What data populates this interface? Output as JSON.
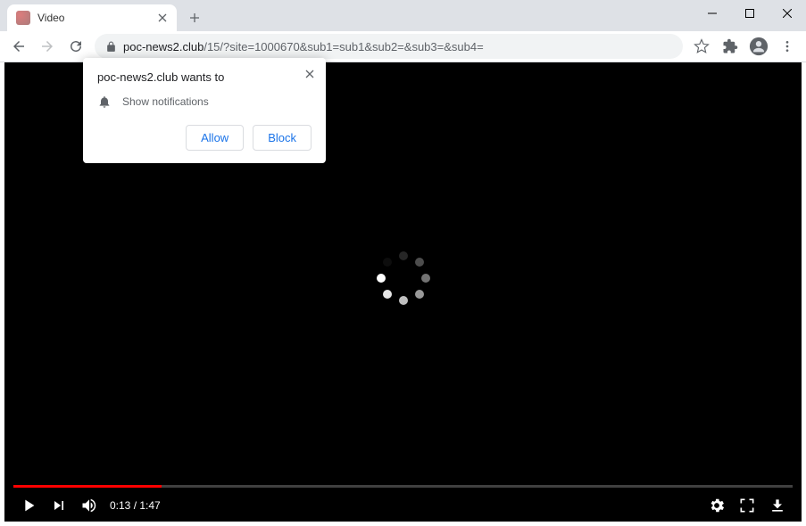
{
  "window": {
    "minimize_tip": "Minimize",
    "maximize_tip": "Maximize",
    "close_tip": "Close"
  },
  "tab": {
    "title": "Video",
    "close_tip": "Close tab",
    "newtab_tip": "New tab"
  },
  "toolbar": {
    "back_tip": "Back",
    "forward_tip": "Forward",
    "reload_tip": "Reload",
    "url_host": "poc-news2.club",
    "url_path": "/15/?site=1000670&sub1=sub1&sub2=&sub3=&sub4=",
    "star_tip": "Bookmark",
    "ext_tip": "Extensions",
    "profile_tip": "Profile",
    "menu_tip": "Menu"
  },
  "permission": {
    "title": "poc-news2.club wants to",
    "item": "Show notifications",
    "allow": "Allow",
    "block": "Block",
    "close_tip": "Close"
  },
  "video": {
    "play_tip": "Play",
    "next_tip": "Next",
    "volume_tip": "Mute",
    "time_current": "0:13",
    "time_sep": " / ",
    "time_total": "1:47",
    "settings_tip": "Settings",
    "fullscreen_tip": "Full screen",
    "download_tip": "Download",
    "progress_percent": 19
  },
  "colors": {
    "accent_red": "#ff0000",
    "link_blue": "#1a73e8",
    "chrome_bg": "#dee1e6"
  }
}
